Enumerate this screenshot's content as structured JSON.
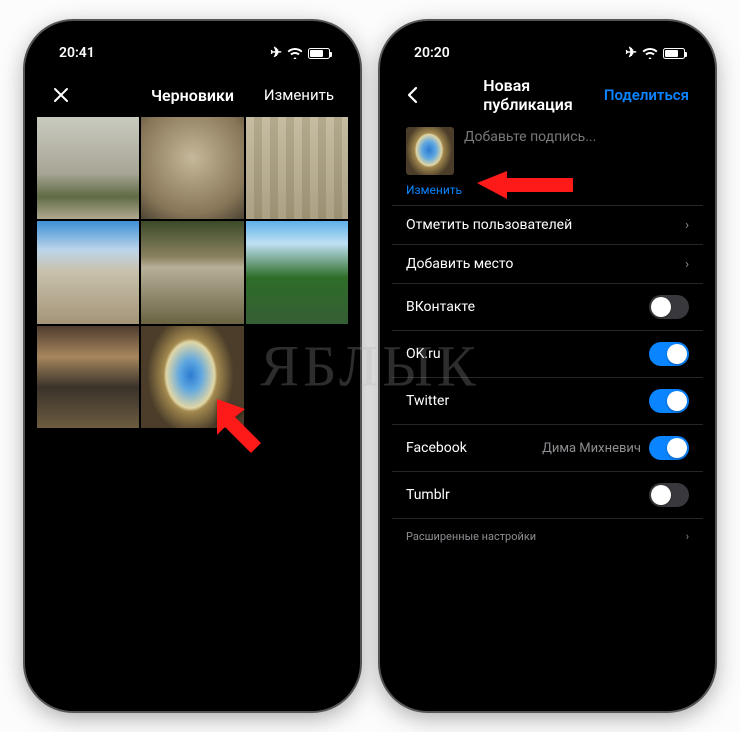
{
  "left_phone": {
    "time": "20:41",
    "title": "Черновики",
    "action": "Изменить",
    "thumbs": [
      "th1",
      "th2",
      "th3",
      "th4",
      "th5",
      "th6",
      "th7",
      "th8"
    ]
  },
  "right_phone": {
    "time": "20:20",
    "title": "Новая публикация",
    "share": "Поделиться",
    "caption_placeholder": "Добавьте подпись...",
    "edit_label": "Изменить",
    "rows": {
      "tag_users": "Отметить пользователей",
      "add_location": "Добавить место",
      "vk": "ВКонтакте",
      "okru": "OK.ru",
      "twitter": "Twitter",
      "facebook": "Facebook",
      "facebook_account": "Дима Михневич",
      "tumblr": "Tumblr",
      "advanced": "Расширенные настройки"
    },
    "toggles": {
      "vk": false,
      "okru": true,
      "twitter": true,
      "facebook": true,
      "tumblr": false
    }
  },
  "watermark": "ЯБЛЫК"
}
